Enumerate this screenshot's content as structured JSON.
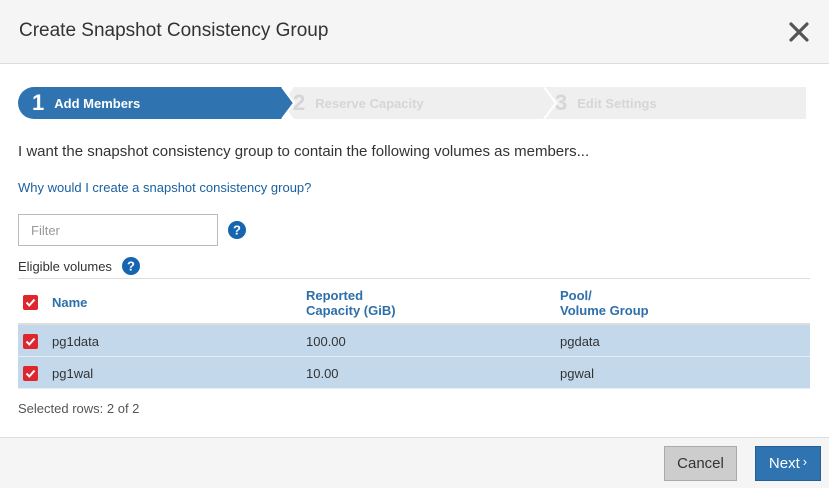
{
  "dialog": {
    "title": "Create Snapshot Consistency Group"
  },
  "wizard": {
    "steps": [
      {
        "number": "1",
        "label": "Add Members",
        "state": "active"
      },
      {
        "number": "2",
        "label": "Reserve Capacity",
        "state": "inactive"
      },
      {
        "number": "3",
        "label": "Edit Settings",
        "state": "inactive"
      }
    ],
    "active_color": "#2f73b1",
    "inactive_color": "#efefef"
  },
  "main": {
    "intro": "I want the snapshot consistency group to contain the following volumes as members...",
    "why_link": "Why would I create a snapshot consistency group?",
    "filter": {
      "placeholder": "Filter",
      "value": ""
    },
    "eligible_label": "Eligible volumes"
  },
  "table": {
    "headers": {
      "name": "Name",
      "capacity": [
        "Reported",
        "Capacity (GiB)"
      ],
      "pool": [
        "Pool/",
        "Volume Group"
      ]
    },
    "header_checked": true,
    "rows": [
      {
        "name": "pg1data",
        "capacity": "100.00",
        "pool": "pgdata",
        "checked": true
      },
      {
        "name": "pg1wal",
        "capacity": "10.00",
        "pool": "pgwal",
        "checked": true
      }
    ],
    "selected_text": "Selected rows: 2 of 2",
    "selected_row_color": "#c3d9eb",
    "checkbox_color": "#e0262d"
  },
  "footer": {
    "cancel_label": "Cancel",
    "next_label": "Next",
    "next_icon": "chevron-right-icon"
  }
}
